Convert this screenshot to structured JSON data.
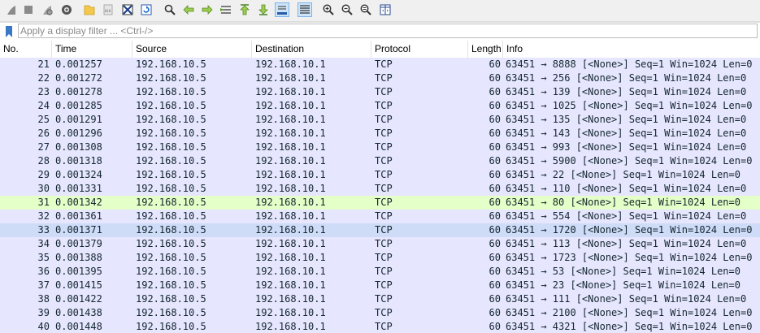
{
  "toolbar": {
    "icons": [
      "shark-fin-start-icon",
      "stop-square-icon",
      "shark-fin-restart-icon",
      "gear-options-icon",
      "open-folder-icon",
      "save-file-icon",
      "close-file-icon",
      "reload-icon",
      "find-packet-icon",
      "go-back-icon",
      "go-forward-icon",
      "go-to-packet-icon",
      "go-first-icon",
      "go-last-icon",
      "autoscroll-icon",
      "colorize-icon",
      "zoom-in-icon",
      "zoom-out-icon",
      "zoom-normal-icon",
      "resize-columns-icon"
    ]
  },
  "filter": {
    "placeholder": "Apply a display filter ... <Ctrl-/>"
  },
  "columns": {
    "no": "No.",
    "time": "Time",
    "source": "Source",
    "destination": "Destination",
    "protocol": "Protocol",
    "length": "Length",
    "info": "Info"
  },
  "colors": {
    "row_tcp": "#e7e6ff",
    "row_highlight": "#e4ffc7",
    "row_selected": "#cfdcf8",
    "text": "#12272e"
  },
  "packets": [
    {
      "no": "21",
      "time": "0.001257",
      "src": "192.168.10.5",
      "dst": "192.168.10.1",
      "proto": "TCP",
      "len": "60",
      "info": "63451 → 8888 [<None>] Seq=1 Win=1024 Len=0"
    },
    {
      "no": "22",
      "time": "0.001272",
      "src": "192.168.10.5",
      "dst": "192.168.10.1",
      "proto": "TCP",
      "len": "60",
      "info": "63451 → 256 [<None>] Seq=1 Win=1024 Len=0"
    },
    {
      "no": "23",
      "time": "0.001278",
      "src": "192.168.10.5",
      "dst": "192.168.10.1",
      "proto": "TCP",
      "len": "60",
      "info": "63451 → 139 [<None>] Seq=1 Win=1024 Len=0"
    },
    {
      "no": "24",
      "time": "0.001285",
      "src": "192.168.10.5",
      "dst": "192.168.10.1",
      "proto": "TCP",
      "len": "60",
      "info": "63451 → 1025 [<None>] Seq=1 Win=1024 Len=0"
    },
    {
      "no": "25",
      "time": "0.001291",
      "src": "192.168.10.5",
      "dst": "192.168.10.1",
      "proto": "TCP",
      "len": "60",
      "info": "63451 → 135 [<None>] Seq=1 Win=1024 Len=0"
    },
    {
      "no": "26",
      "time": "0.001296",
      "src": "192.168.10.5",
      "dst": "192.168.10.1",
      "proto": "TCP",
      "len": "60",
      "info": "63451 → 143 [<None>] Seq=1 Win=1024 Len=0"
    },
    {
      "no": "27",
      "time": "0.001308",
      "src": "192.168.10.5",
      "dst": "192.168.10.1",
      "proto": "TCP",
      "len": "60",
      "info": "63451 → 993 [<None>] Seq=1 Win=1024 Len=0"
    },
    {
      "no": "28",
      "time": "0.001318",
      "src": "192.168.10.5",
      "dst": "192.168.10.1",
      "proto": "TCP",
      "len": "60",
      "info": "63451 → 5900 [<None>] Seq=1 Win=1024 Len=0"
    },
    {
      "no": "29",
      "time": "0.001324",
      "src": "192.168.10.5",
      "dst": "192.168.10.1",
      "proto": "TCP",
      "len": "60",
      "info": "63451 → 22 [<None>] Seq=1 Win=1024 Len=0"
    },
    {
      "no": "30",
      "time": "0.001331",
      "src": "192.168.10.5",
      "dst": "192.168.10.1",
      "proto": "TCP",
      "len": "60",
      "info": "63451 → 110 [<None>] Seq=1 Win=1024 Len=0"
    },
    {
      "no": "31",
      "time": "0.001342",
      "src": "192.168.10.5",
      "dst": "192.168.10.1",
      "proto": "TCP",
      "len": "60",
      "info": "63451 → 80 [<None>] Seq=1 Win=1024 Len=0",
      "state": "highlight"
    },
    {
      "no": "32",
      "time": "0.001361",
      "src": "192.168.10.5",
      "dst": "192.168.10.1",
      "proto": "TCP",
      "len": "60",
      "info": "63451 → 554 [<None>] Seq=1 Win=1024 Len=0"
    },
    {
      "no": "33",
      "time": "0.001371",
      "src": "192.168.10.5",
      "dst": "192.168.10.1",
      "proto": "TCP",
      "len": "60",
      "info": "63451 → 1720 [<None>] Seq=1 Win=1024 Len=0",
      "state": "selected"
    },
    {
      "no": "34",
      "time": "0.001379",
      "src": "192.168.10.5",
      "dst": "192.168.10.1",
      "proto": "TCP",
      "len": "60",
      "info": "63451 → 113 [<None>] Seq=1 Win=1024 Len=0"
    },
    {
      "no": "35",
      "time": "0.001388",
      "src": "192.168.10.5",
      "dst": "192.168.10.1",
      "proto": "TCP",
      "len": "60",
      "info": "63451 → 1723 [<None>] Seq=1 Win=1024 Len=0"
    },
    {
      "no": "36",
      "time": "0.001395",
      "src": "192.168.10.5",
      "dst": "192.168.10.1",
      "proto": "TCP",
      "len": "60",
      "info": "63451 → 53 [<None>] Seq=1 Win=1024 Len=0"
    },
    {
      "no": "37",
      "time": "0.001415",
      "src": "192.168.10.5",
      "dst": "192.168.10.1",
      "proto": "TCP",
      "len": "60",
      "info": "63451 → 23 [<None>] Seq=1 Win=1024 Len=0"
    },
    {
      "no": "38",
      "time": "0.001422",
      "src": "192.168.10.5",
      "dst": "192.168.10.1",
      "proto": "TCP",
      "len": "60",
      "info": "63451 → 111 [<None>] Seq=1 Win=1024 Len=0"
    },
    {
      "no": "39",
      "time": "0.001438",
      "src": "192.168.10.5",
      "dst": "192.168.10.1",
      "proto": "TCP",
      "len": "60",
      "info": "63451 → 2100 [<None>] Seq=1 Win=1024 Len=0"
    },
    {
      "no": "40",
      "time": "0.001448",
      "src": "192.168.10.5",
      "dst": "192.168.10.1",
      "proto": "TCP",
      "len": "60",
      "info": "63451 → 4321 [<None>] Seq=1 Win=1024 Len=0"
    }
  ]
}
